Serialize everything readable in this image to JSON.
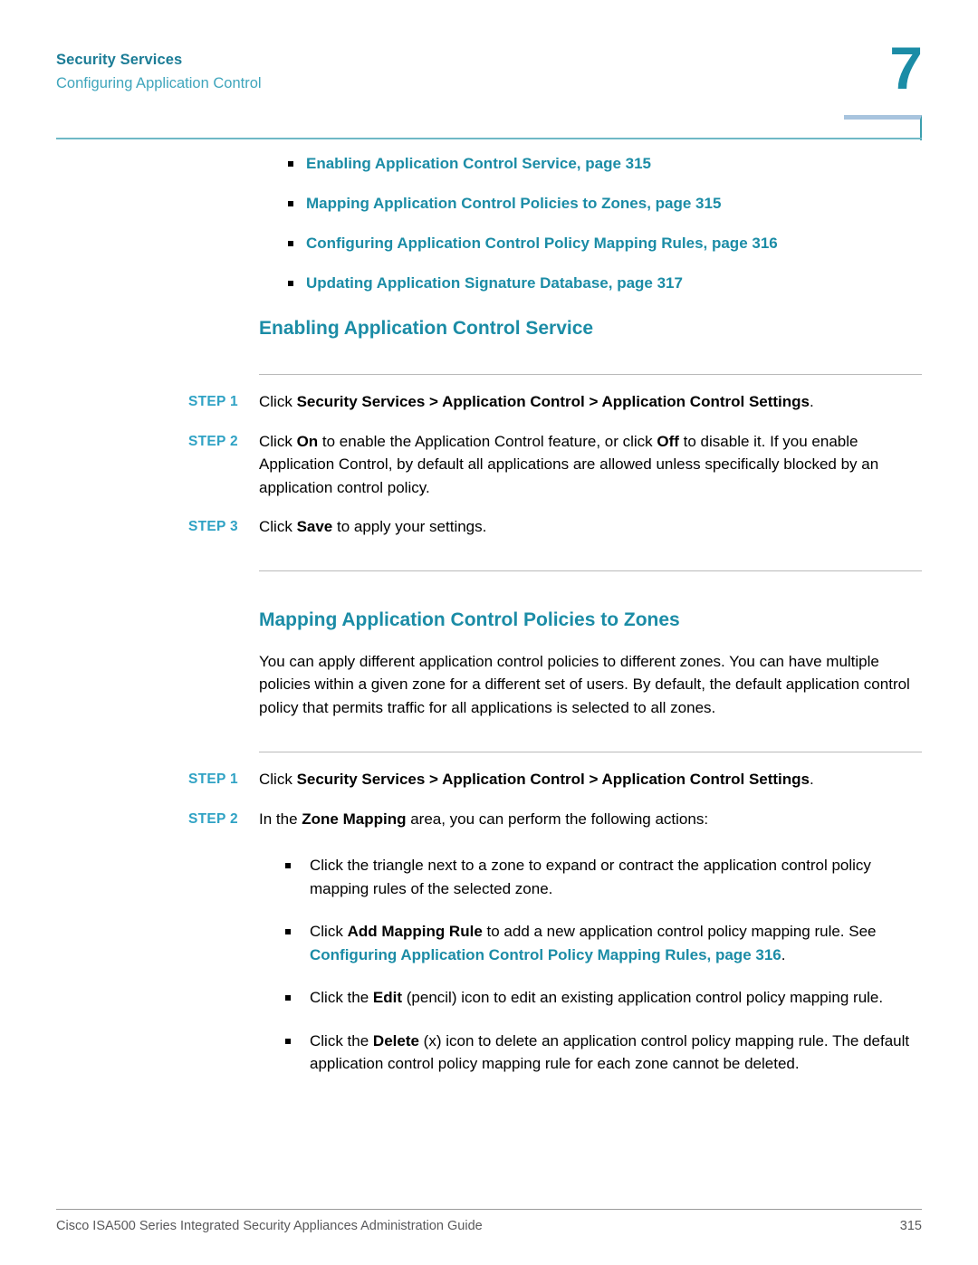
{
  "header": {
    "chapter_title": "Security Services",
    "section_title": "Configuring Application Control",
    "chapter_number": "7"
  },
  "xref_list": [
    "Enabling Application Control Service, page 315",
    "Mapping Application Control Policies to Zones, page 315",
    "Configuring Application Control Policy Mapping Rules, page 316",
    "Updating Application Signature Database, page 317"
  ],
  "sections": [
    {
      "heading": "Enabling Application Control Service",
      "steps": [
        {
          "label": "STEP 1",
          "parts": [
            {
              "text": "Click ",
              "style": "normal"
            },
            {
              "text": "Security Services > Application Control > Application Control Settings",
              "style": "bold"
            },
            {
              "text": ".",
              "style": "normal"
            }
          ]
        },
        {
          "label": "STEP 2",
          "parts": [
            {
              "text": "Click ",
              "style": "normal"
            },
            {
              "text": "On",
              "style": "bold"
            },
            {
              "text": " to enable the Application Control feature, or click ",
              "style": "normal"
            },
            {
              "text": "Off",
              "style": "bold"
            },
            {
              "text": " to disable it. If you enable Application Control, by default all applications are allowed unless specifically blocked by an application control policy.",
              "style": "normal"
            }
          ]
        },
        {
          "label": "STEP 3",
          "parts": [
            {
              "text": "Click ",
              "style": "normal"
            },
            {
              "text": "Save",
              "style": "bold"
            },
            {
              "text": " to apply your settings.",
              "style": "normal"
            }
          ]
        }
      ]
    },
    {
      "heading": "Mapping Application Control Policies to Zones",
      "paragraph": "You can apply different application control policies to different zones. You can have multiple policies within a given zone for a different set of users. By default, the default application control policy that permits traffic for all applications is selected to all zones.",
      "steps": [
        {
          "label": "STEP 1",
          "parts": [
            {
              "text": "Click ",
              "style": "normal"
            },
            {
              "text": "Security Services > Application Control > Application Control Settings",
              "style": "bold"
            },
            {
              "text": ".",
              "style": "normal"
            }
          ]
        },
        {
          "label": "STEP 2",
          "parts": [
            {
              "text": "In the ",
              "style": "normal"
            },
            {
              "text": "Zone Mapping",
              "style": "bold"
            },
            {
              "text": " area, you can perform the following actions:",
              "style": "normal"
            }
          ]
        }
      ],
      "actions": [
        {
          "parts": [
            {
              "text": "Click the triangle next to a zone to expand or contract the application control policy mapping rules of the selected zone.",
              "style": "normal"
            }
          ]
        },
        {
          "parts": [
            {
              "text": "Click ",
              "style": "normal"
            },
            {
              "text": "Add Mapping Rule",
              "style": "bold"
            },
            {
              "text": " to add a new application control policy mapping rule. See ",
              "style": "normal"
            },
            {
              "text": "Configuring Application Control Policy Mapping Rules, page 316",
              "style": "link"
            },
            {
              "text": ".",
              "style": "normal"
            }
          ]
        },
        {
          "parts": [
            {
              "text": "Click the ",
              "style": "normal"
            },
            {
              "text": "Edit",
              "style": "bold"
            },
            {
              "text": " (pencil) icon to edit an existing application control policy mapping rule.",
              "style": "normal"
            }
          ]
        },
        {
          "parts": [
            {
              "text": "Click the ",
              "style": "normal"
            },
            {
              "text": "Delete",
              "style": "bold"
            },
            {
              "text": " (x) icon to delete an application control policy mapping rule. The default application control policy mapping rule for each zone cannot be deleted.",
              "style": "normal"
            }
          ]
        }
      ]
    }
  ],
  "footer": {
    "document_title": "Cisco ISA500 Series Integrated Security Appliances Administration Guide",
    "page_number": "315"
  },
  "colors": {
    "teal_link": "#1B8CA6",
    "teal_light": "#3FA5BC",
    "step_label": "#2FA2C4",
    "rule_gray": "#b9b9b9",
    "box_top_bar": "#A8C4DE"
  }
}
